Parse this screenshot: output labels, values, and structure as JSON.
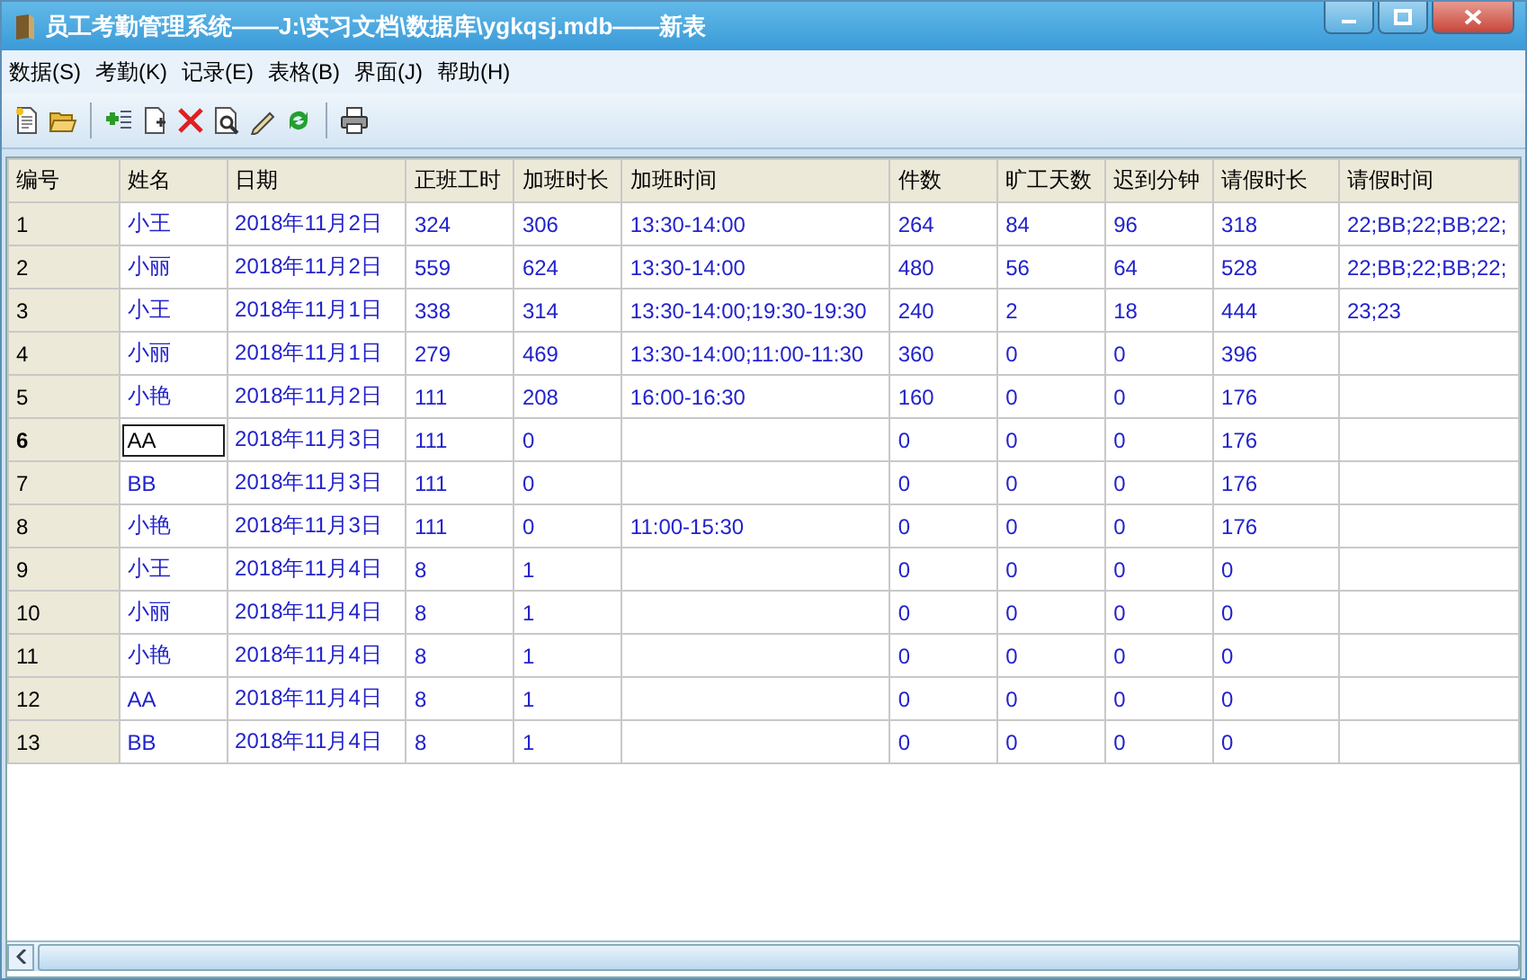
{
  "window": {
    "title": "员工考勤管理系统——J:\\实习文档\\数据库\\ygkqsj.mdb——新表"
  },
  "menu": [
    "数据(S)",
    "考勤(K)",
    "记录(E)",
    "表格(B)",
    "界面(J)",
    "帮助(H)"
  ],
  "toolbar": [
    {
      "kind": "new"
    },
    {
      "kind": "open"
    },
    {
      "kind": "sep"
    },
    {
      "kind": "add"
    },
    {
      "kind": "page"
    },
    {
      "kind": "delete"
    },
    {
      "kind": "preview"
    },
    {
      "kind": "edit"
    },
    {
      "kind": "refresh"
    },
    {
      "kind": "sep"
    },
    {
      "kind": "print"
    }
  ],
  "table": {
    "columns": [
      "编号",
      "姓名",
      "日期",
      "正班工时",
      "加班时长",
      "加班时间",
      "件数",
      "旷工天数",
      "迟到分钟",
      "请假时长",
      "请假时间"
    ],
    "rows": [
      {
        "selected": false,
        "cells": [
          "1",
          "小王",
          "2018年11月2日",
          "324",
          "306",
          "13:30-14:00",
          "264",
          "84",
          "96",
          "318",
          "22;BB;22;BB;22;"
        ]
      },
      {
        "selected": false,
        "cells": [
          "2",
          "小丽",
          "2018年11月2日",
          "559",
          "624",
          "13:30-14:00",
          "480",
          "56",
          "64",
          "528",
          "22;BB;22;BB;22;"
        ]
      },
      {
        "selected": false,
        "cells": [
          "3",
          "小王",
          "2018年11月1日",
          "338",
          "314",
          "13:30-14:00;19:30-19:30",
          "240",
          "2",
          "18",
          "444",
          "23;23"
        ]
      },
      {
        "selected": false,
        "cells": [
          "4",
          "小丽",
          "2018年11月1日",
          "279",
          "469",
          "13:30-14:00;11:00-11:30",
          "360",
          "0",
          "0",
          "396",
          ""
        ]
      },
      {
        "selected": false,
        "cells": [
          "5",
          "小艳",
          "2018年11月2日",
          "111",
          "208",
          "16:00-16:30",
          "160",
          "0",
          "0",
          "176",
          ""
        ]
      },
      {
        "selected": true,
        "cells": [
          "6",
          "AA",
          "2018年11月3日",
          "111",
          "0",
          "",
          "0",
          "0",
          "0",
          "176",
          ""
        ]
      },
      {
        "selected": false,
        "cells": [
          "7",
          "BB",
          "2018年11月3日",
          "111",
          "0",
          "",
          "0",
          "0",
          "0",
          "176",
          ""
        ]
      },
      {
        "selected": false,
        "cells": [
          "8",
          "小艳",
          "2018年11月3日",
          "111",
          "0",
          "11:00-15:30",
          "0",
          "0",
          "0",
          "176",
          ""
        ]
      },
      {
        "selected": false,
        "cells": [
          "9",
          "小王",
          "2018年11月4日",
          "8",
          "1",
          "",
          "0",
          "0",
          "0",
          "0",
          ""
        ]
      },
      {
        "selected": false,
        "cells": [
          "10",
          "小丽",
          "2018年11月4日",
          "8",
          "1",
          "",
          "0",
          "0",
          "0",
          "0",
          ""
        ]
      },
      {
        "selected": false,
        "cells": [
          "11",
          "小艳",
          "2018年11月4日",
          "8",
          "1",
          "",
          "0",
          "0",
          "0",
          "0",
          ""
        ]
      },
      {
        "selected": false,
        "cells": [
          "12",
          "AA",
          "2018年11月4日",
          "8",
          "1",
          "",
          "0",
          "0",
          "0",
          "0",
          ""
        ]
      },
      {
        "selected": false,
        "cells": [
          "13",
          "BB",
          "2018年11月4日",
          "8",
          "1",
          "",
          "0",
          "0",
          "0",
          "0",
          ""
        ]
      }
    ]
  }
}
